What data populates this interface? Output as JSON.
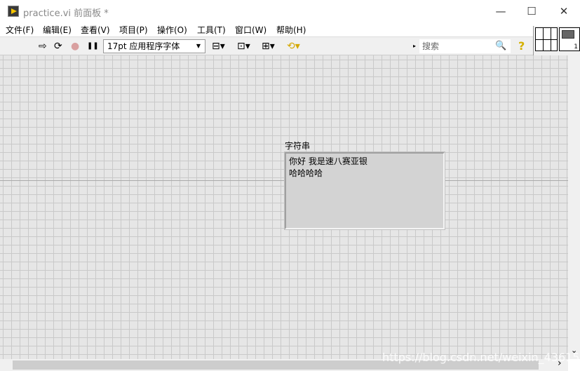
{
  "window": {
    "title": "practice.vi 前面板 *",
    "minimize": "—",
    "maximize": "☐",
    "close": "✕"
  },
  "menu": [
    "文件(F)",
    "编辑(E)",
    "查看(V)",
    "项目(P)",
    "操作(O)",
    "工具(T)",
    "窗口(W)",
    "帮助(H)"
  ],
  "toolbar": {
    "run": "⇨",
    "run_continuous": "⟳",
    "abort": "●",
    "pause": "❚❚",
    "font": "17pt 应用程序字体",
    "align": "⊟▾",
    "distribute": "⊡▾",
    "resize": "⊞▾",
    "reorder": "⟲▾",
    "search_placeholder": "搜索",
    "search_icon": "🔍",
    "help": "?"
  },
  "icon_panel": {
    "connector_pane": "connector-pane",
    "vi_icon_number": "1"
  },
  "front_panel": {
    "string_control": {
      "label": "字符串",
      "value": "你好 我是速八赛亚银\n哈哈哈哈"
    }
  },
  "scroll": {
    "down": "⌄",
    "right": "›"
  },
  "watermark": "https://blog.csdn.net/weixin_43615392",
  "colors": {
    "canvas": "#e6e6e6",
    "grid": "#c9c9c9",
    "string_bg": "#d3d3d3"
  }
}
